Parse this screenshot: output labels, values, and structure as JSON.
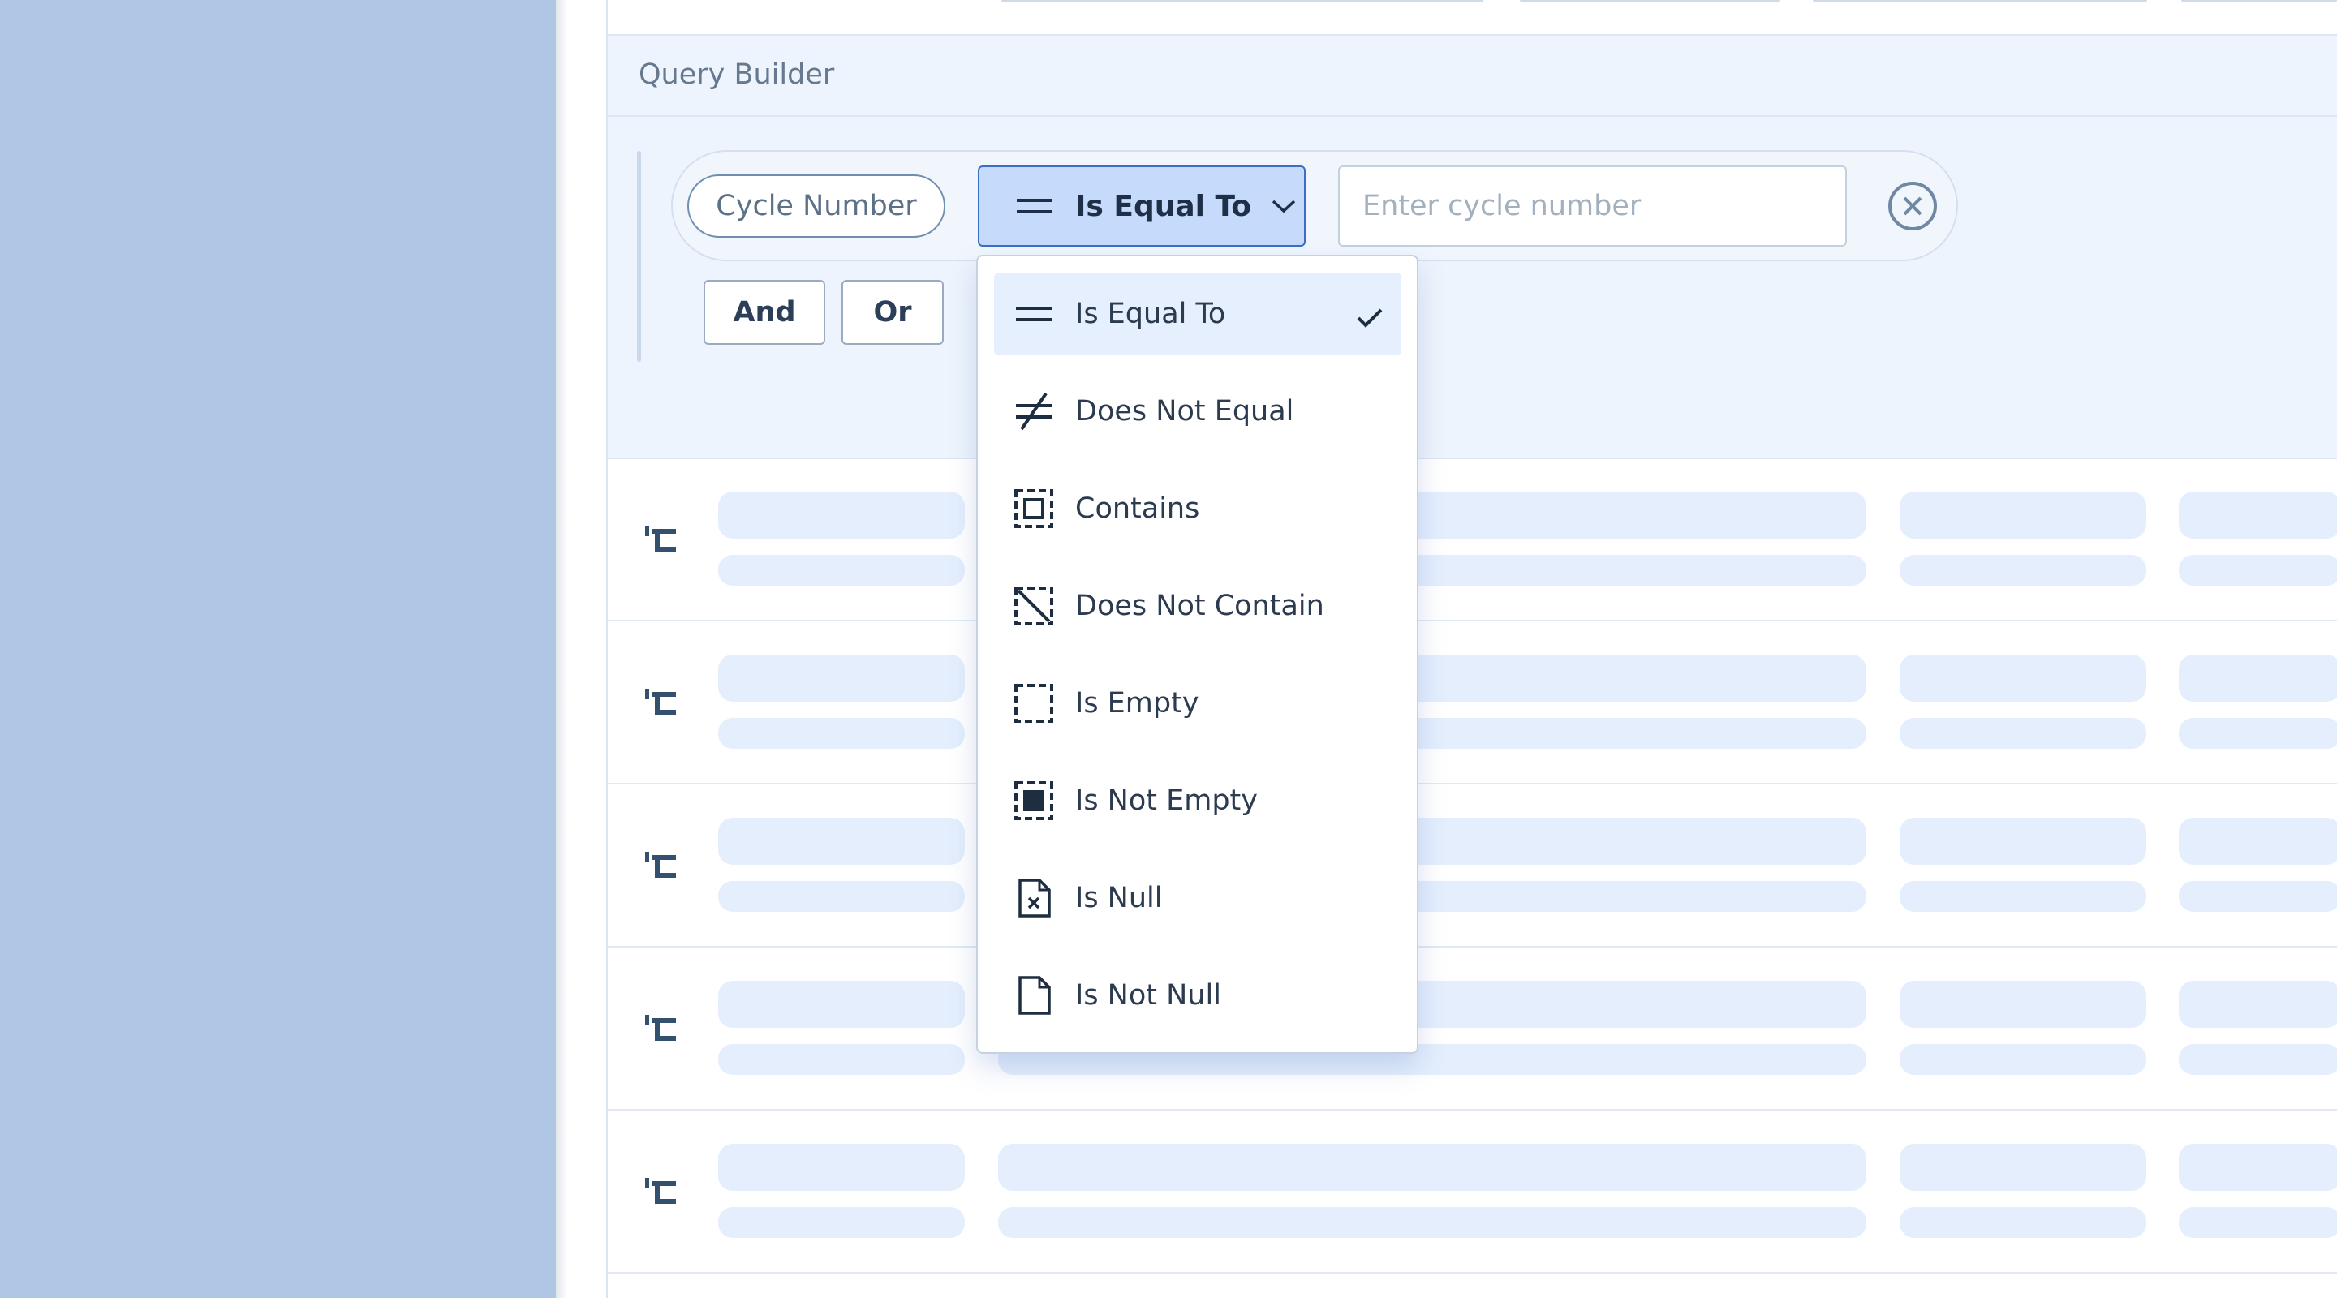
{
  "query_builder": {
    "title": "Query Builder",
    "condition": {
      "field_label": "Cycle Number",
      "operator_label": "Is Equal To",
      "value": "",
      "value_placeholder": "Enter cycle number"
    },
    "logic_buttons": {
      "and_label": "And",
      "or_label": "Or"
    }
  },
  "operator_menu": {
    "selected": "Is Equal To",
    "options": [
      {
        "label": "Is Equal To",
        "icon": "equals-icon",
        "selected": true
      },
      {
        "label": "Does Not Equal",
        "icon": "not-equal-icon",
        "selected": false
      },
      {
        "label": "Contains",
        "icon": "contains-icon",
        "selected": false
      },
      {
        "label": "Does Not Contain",
        "icon": "does-not-contain-icon",
        "selected": false
      },
      {
        "label": "Is Empty",
        "icon": "empty-box-icon",
        "selected": false
      },
      {
        "label": "Is Not Empty",
        "icon": "filled-box-icon",
        "selected": false
      },
      {
        "label": "Is Null",
        "icon": "document-x-icon",
        "selected": false
      },
      {
        "label": "Is Not Null",
        "icon": "document-icon",
        "selected": false
      }
    ]
  },
  "results": {
    "loading_rows": 5,
    "row_icon": "hierarchy-icon"
  },
  "colors": {
    "backdrop": "#b0c6e5",
    "accent": "#3b6fc4",
    "selected_bg": "#c6dbfb",
    "skeleton": "#e4eefd"
  }
}
